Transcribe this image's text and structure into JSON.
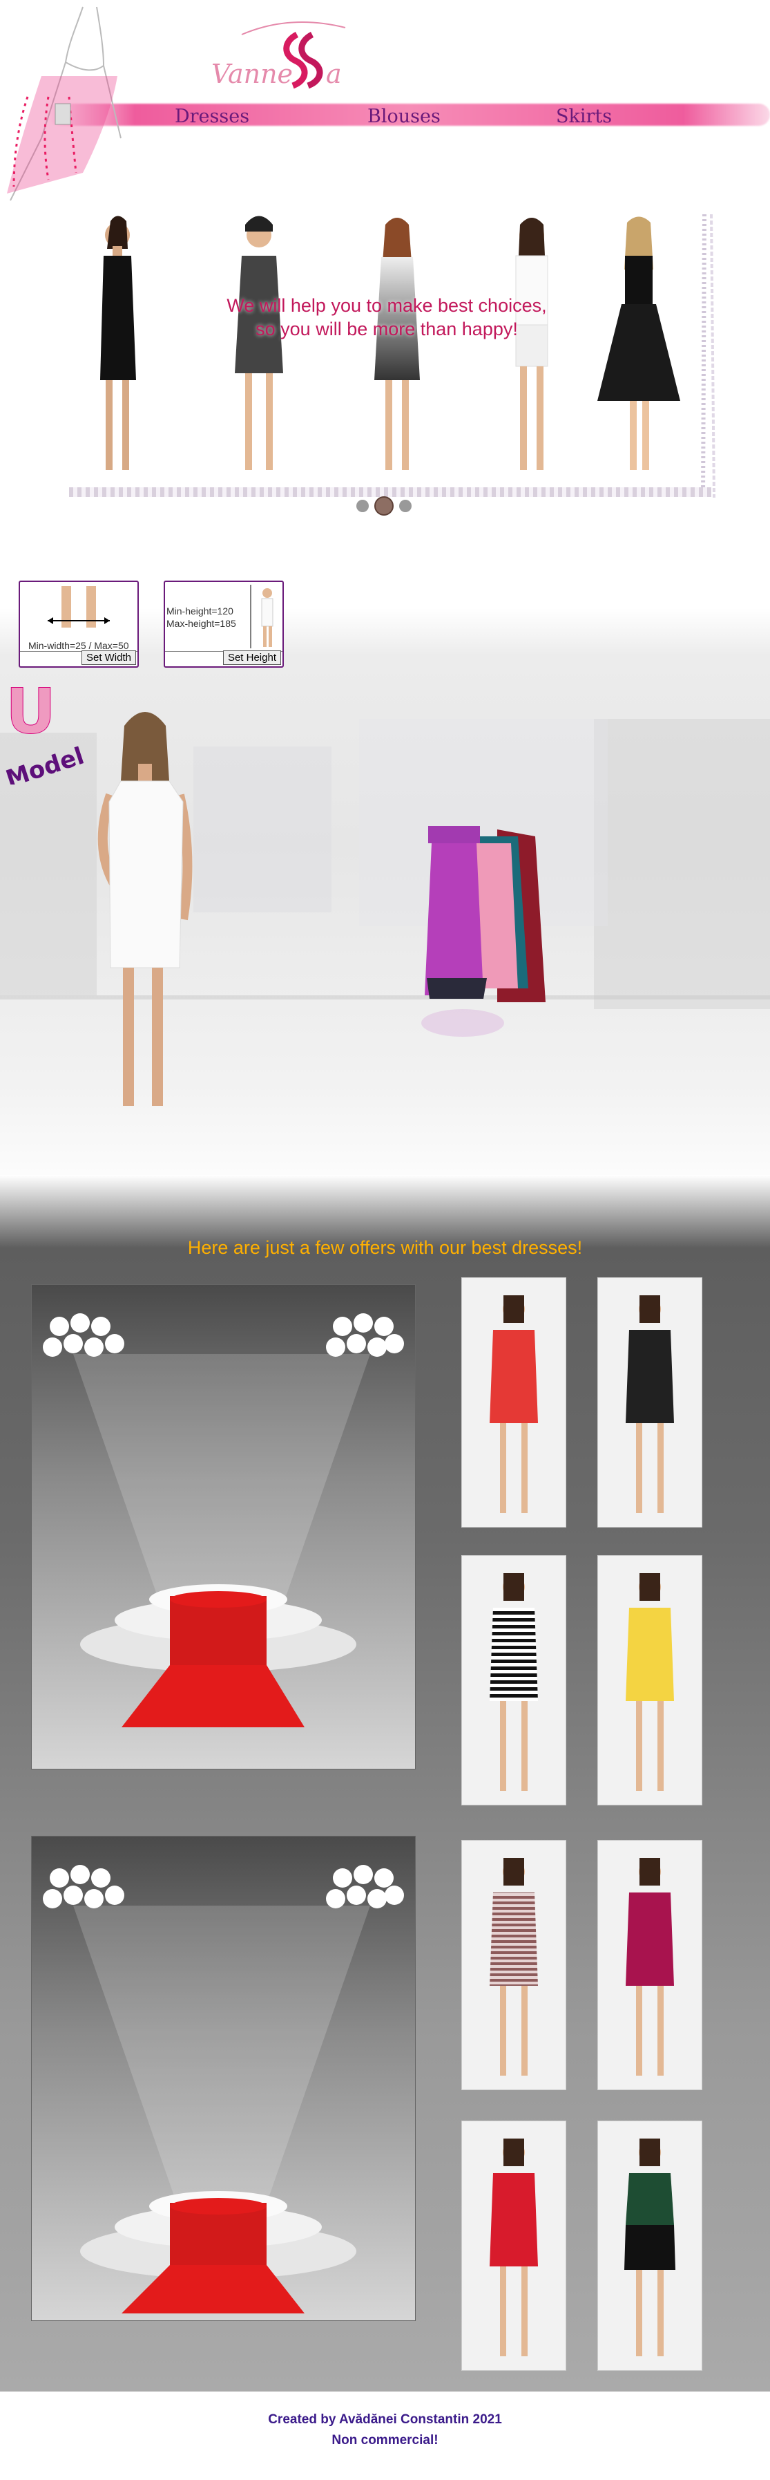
{
  "header": {
    "logo_text": "Vanne ssa",
    "nav": [
      {
        "label": "Dresses"
      },
      {
        "label": "Blouses"
      },
      {
        "label": "Skirts"
      }
    ]
  },
  "slider": {
    "caption_line1": "We will help you to make best choices,",
    "caption_line2": "so you will be more than happy!",
    "slide_count": 3,
    "active_slide": 2
  },
  "controls": {
    "width_box": {
      "label": "Min-width=25 / Max=50",
      "button": "Set Width"
    },
    "height_box": {
      "label_line1": "Min-height=120",
      "label_line2": "Max-height=185",
      "button": "Set Height"
    }
  },
  "store": {
    "model_badge": "Model",
    "model_badge_letter": "U"
  },
  "offers": {
    "title": "Here are just a few offers with our best dresses!",
    "thumbs": [
      {
        "color": "#e53935"
      },
      {
        "color": "#212121"
      },
      {
        "color": "#111111"
      },
      {
        "color": "#f4d442"
      },
      {
        "color": "#8d5a5a"
      },
      {
        "color": "#a8134e"
      },
      {
        "color": "#d81b2c"
      },
      {
        "color": "#1e4d33"
      }
    ]
  },
  "footer": {
    "line1": "Created by Avădănei Constantin 2021",
    "line2": "Non commercial!"
  },
  "colors": {
    "accent_pink": "#ec408c",
    "nav_purple": "#6a1a7a",
    "offers_title": "#ffb000",
    "carpet_red": "#e31b1b"
  }
}
